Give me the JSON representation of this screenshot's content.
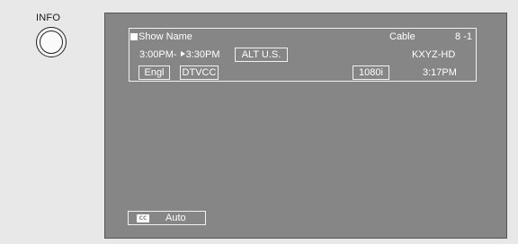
{
  "remote": {
    "info_label": "INFO"
  },
  "banner": {
    "show_name": "Show Name",
    "source": "Cable",
    "channel": "8 -1",
    "time_start": "3:00PM-",
    "time_end": "3:30PM",
    "rating": "ALT U.S.",
    "station": "KXYZ-HD",
    "audio_language": "Engl",
    "caption_service": "DTVCC",
    "resolution": "1080i",
    "clock": "3:17PM"
  },
  "caption_setting": {
    "icon_text": "CC",
    "value": "Auto"
  },
  "icons": {
    "program_marker": "square-icon",
    "current_time_marker": "play-icon",
    "closed_caption": "cc-icon"
  },
  "colors": {
    "screen": "#868686",
    "text": "#ffffff",
    "background": "#e8e8e8"
  }
}
